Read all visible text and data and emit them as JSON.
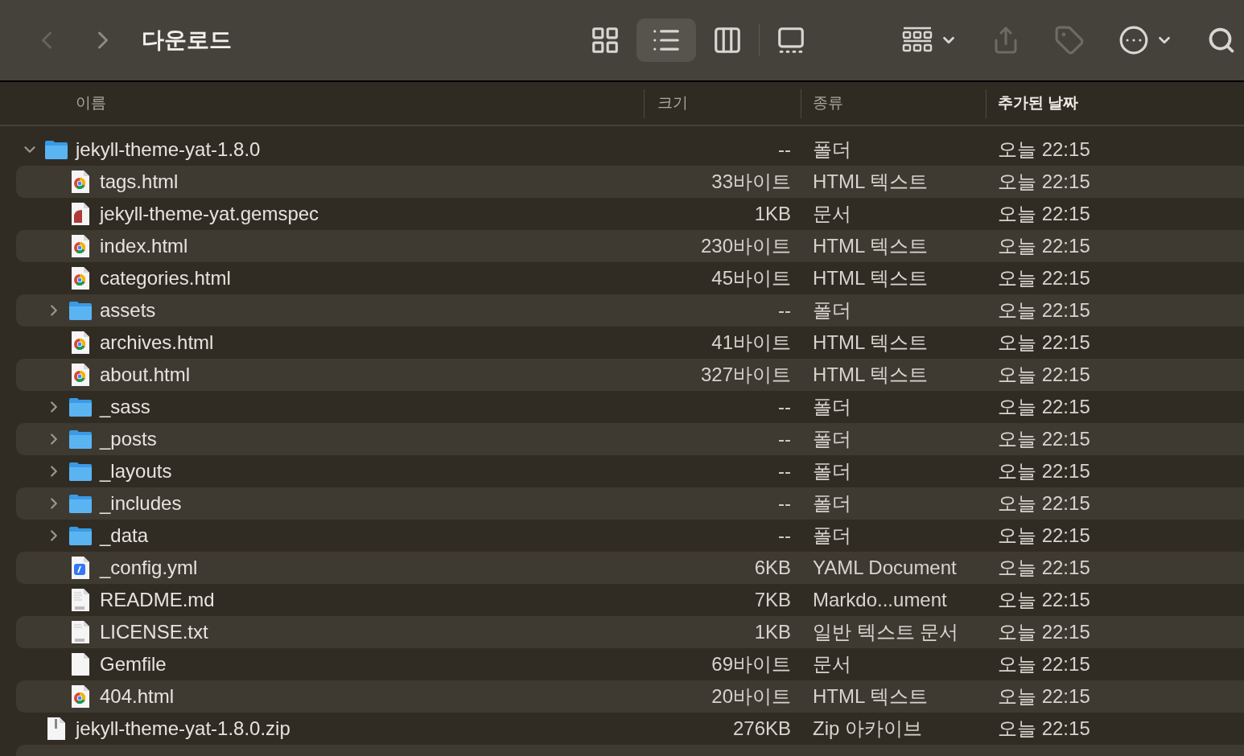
{
  "window": {
    "title": "다운로드"
  },
  "nav": [
    {
      "kind": "back",
      "disabled": true
    },
    {
      "kind": "forward",
      "disabled": false
    }
  ],
  "view_modes": [
    {
      "kind": "icons",
      "selected": false
    },
    {
      "kind": "list",
      "selected": true
    },
    {
      "kind": "columns",
      "selected": false
    },
    {
      "kind": "gallery",
      "selected": false
    }
  ],
  "toolbar": [
    {
      "kind": "group",
      "disabled": false
    },
    {
      "kind": "share",
      "disabled": true
    },
    {
      "kind": "tag",
      "disabled": true
    },
    {
      "kind": "more",
      "disabled": false
    },
    {
      "kind": "search",
      "disabled": false
    }
  ],
  "table": {
    "columns": [
      {
        "label": "이름",
        "sorted": false
      },
      {
        "label": "크기",
        "sorted": false
      },
      {
        "label": "종류",
        "sorted": false
      },
      {
        "label": "추가된 날짜",
        "sorted": true
      }
    ],
    "rows": [
      {
        "name": "jekyll-theme-yat-1.8.0",
        "kind": "folder",
        "expanded": true,
        "size": "--",
        "type": "폴더",
        "date": "오늘 22:15",
        "children": [
          {
            "name": "tags.html",
            "kind": "html",
            "size": "33바이트",
            "type": "HTML 텍스트",
            "date": "오늘 22:15"
          },
          {
            "name": "jekyll-theme-yat.gemspec",
            "kind": "gemspec",
            "size": "1KB",
            "type": "문서",
            "date": "오늘 22:15"
          },
          {
            "name": "index.html",
            "kind": "html",
            "size": "230바이트",
            "type": "HTML 텍스트",
            "date": "오늘 22:15"
          },
          {
            "name": "categories.html",
            "kind": "html",
            "size": "45바이트",
            "type": "HTML 텍스트",
            "date": "오늘 22:15"
          },
          {
            "name": "assets",
            "kind": "folder",
            "expanded": false,
            "size": "--",
            "type": "폴더",
            "date": "오늘 22:15"
          },
          {
            "name": "archives.html",
            "kind": "html",
            "size": "41바이트",
            "type": "HTML 텍스트",
            "date": "오늘 22:15"
          },
          {
            "name": "about.html",
            "kind": "html",
            "size": "327바이트",
            "type": "HTML 텍스트",
            "date": "오늘 22:15"
          },
          {
            "name": "_sass",
            "kind": "folder",
            "expanded": false,
            "size": "--",
            "type": "폴더",
            "date": "오늘 22:15"
          },
          {
            "name": "_posts",
            "kind": "folder",
            "expanded": false,
            "size": "--",
            "type": "폴더",
            "date": "오늘 22:15"
          },
          {
            "name": "_layouts",
            "kind": "folder",
            "expanded": false,
            "size": "--",
            "type": "폴더",
            "date": "오늘 22:15"
          },
          {
            "name": "_includes",
            "kind": "folder",
            "expanded": false,
            "size": "--",
            "type": "폴더",
            "date": "오늘 22:15"
          },
          {
            "name": "_data",
            "kind": "folder",
            "expanded": false,
            "size": "--",
            "type": "폴더",
            "date": "오늘 22:15"
          },
          {
            "name": "_config.yml",
            "kind": "yaml",
            "size": "6KB",
            "type": "YAML Document",
            "date": "오늘 22:15"
          },
          {
            "name": "README.md",
            "kind": "md",
            "size": "7KB",
            "type": "Markdo...ument",
            "date": "오늘 22:15"
          },
          {
            "name": "LICENSE.txt",
            "kind": "txt",
            "size": "1KB",
            "type": "일반 텍스트 문서",
            "date": "오늘 22:15"
          },
          {
            "name": "Gemfile",
            "kind": "plain",
            "size": "69바이트",
            "type": "문서",
            "date": "오늘 22:15"
          },
          {
            "name": "404.html",
            "kind": "html",
            "size": "20바이트",
            "type": "HTML 텍스트",
            "date": "오늘 22:15"
          }
        ]
      },
      {
        "name": "jekyll-theme-yat-1.8.0.zip",
        "kind": "zip",
        "size": "276KB",
        "type": "Zip 아카이브",
        "date": "오늘 22:15"
      }
    ]
  }
}
